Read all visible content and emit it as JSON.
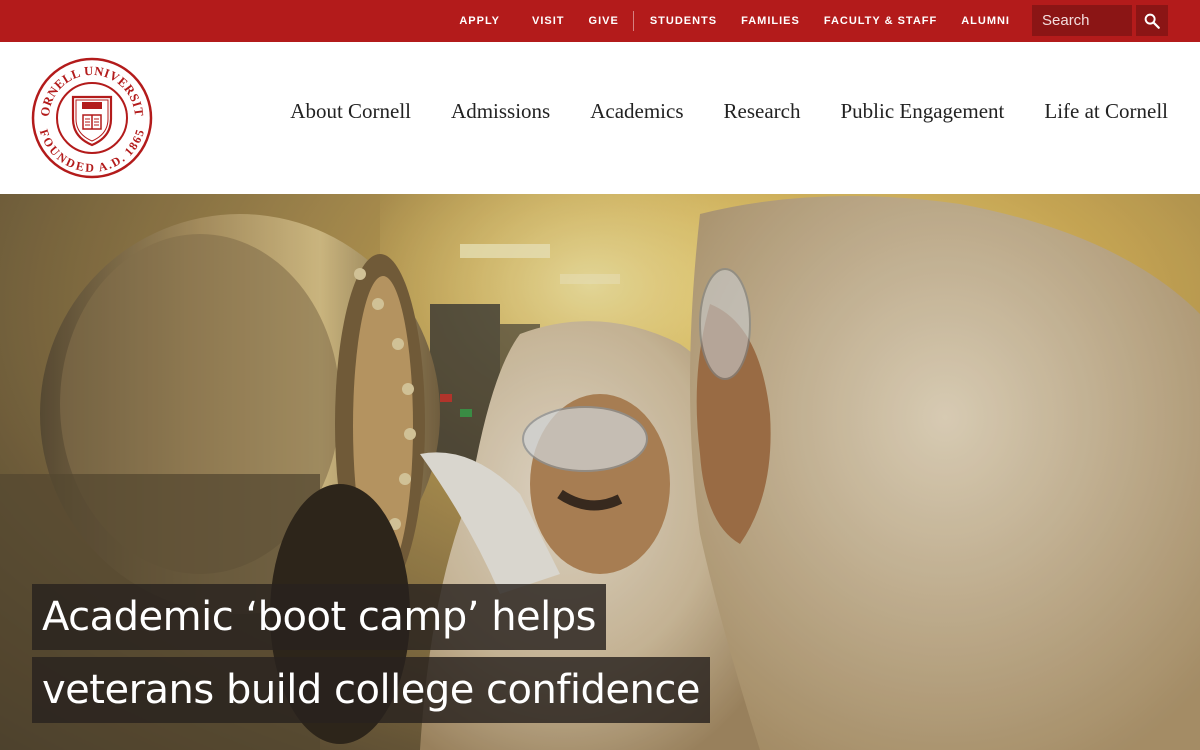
{
  "utility_nav": {
    "links": [
      "APPLY",
      "VISIT",
      "GIVE",
      "STUDENTS",
      "FAMILIES",
      "FACULTY & STAFF",
      "ALUMNI"
    ]
  },
  "search": {
    "placeholder": "Search",
    "icon": "search-icon"
  },
  "logo": {
    "text_top": "CORNELL UNIVERSITY",
    "text_bottom": "FOUNDED A.D. 1865",
    "icon": "university-seal"
  },
  "main_nav": {
    "items": [
      "About Cornell",
      "Admissions",
      "Academics",
      "Research",
      "Public Engagement",
      "Life at Cornell"
    ]
  },
  "hero": {
    "headline_line1": "Academic ‘boot camp’ helps",
    "headline_line2": "veterans build college confidence"
  },
  "colors": {
    "brand_red": "#b31b1b",
    "search_bg": "#8b1515"
  }
}
